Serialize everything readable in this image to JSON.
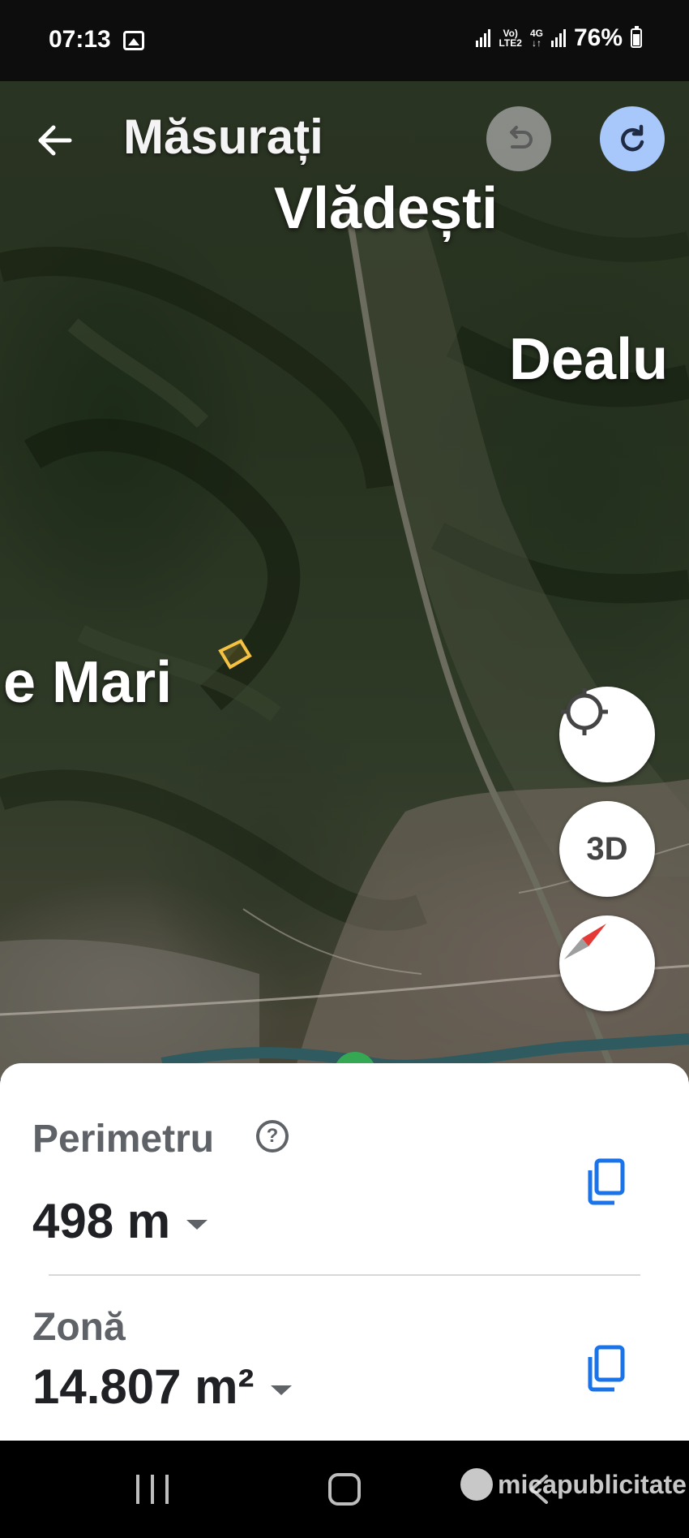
{
  "status_bar": {
    "time": "07:13",
    "net_line1": "Vo)",
    "net_line2": "LTE2",
    "net_4g": "4G",
    "battery": "76%"
  },
  "header": {
    "title": "Măsurați"
  },
  "map": {
    "places": [
      "Vlădești",
      "Dealu",
      "e Mari"
    ],
    "polygon_color": "#f5c242"
  },
  "controls": {
    "three_d_label": "3D"
  },
  "measurements": {
    "perimeter_label": "Perimetru",
    "perimeter_value": "498 m",
    "area_label": "Zonă",
    "area_value": "14.807 m²"
  },
  "watermark": {
    "text": "micapublicitate"
  },
  "colors": {
    "accent": "#1a73e8",
    "redo_bg": "#a8c7fa",
    "sheet_text": "#202124",
    "label_text": "#5f6368"
  }
}
